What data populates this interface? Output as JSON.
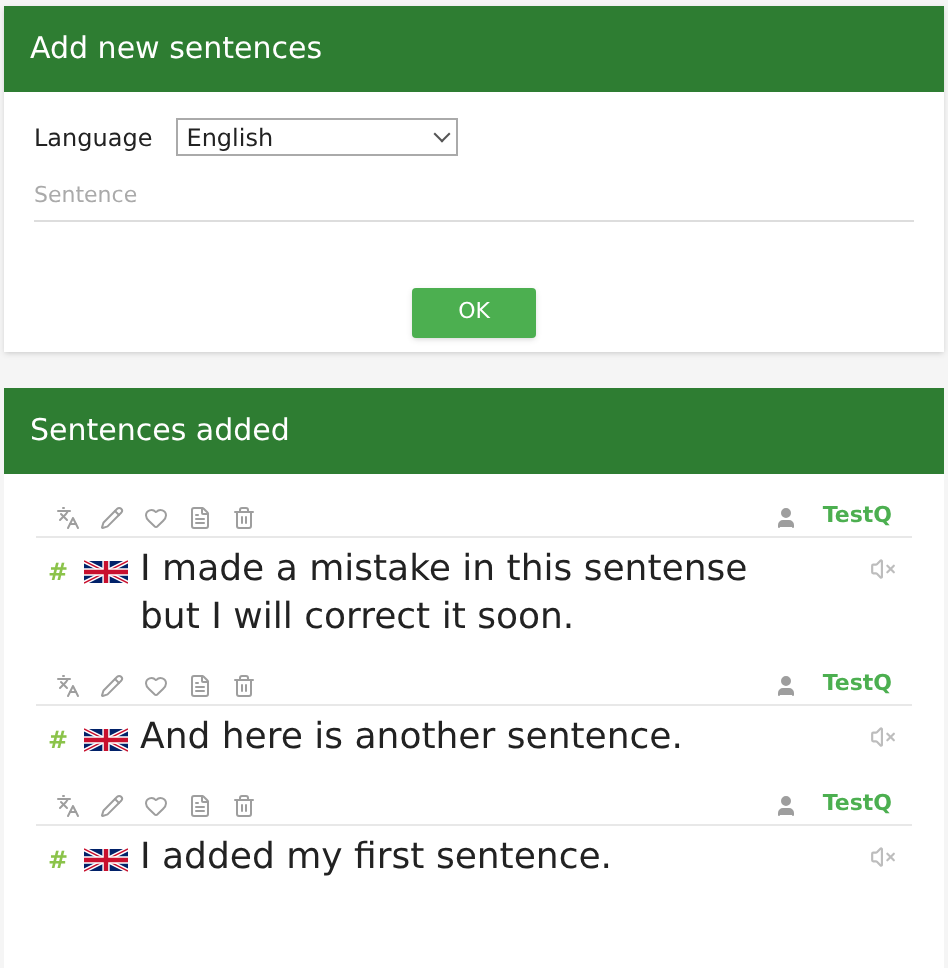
{
  "add_panel": {
    "title": "Add new sentences",
    "language_label": "Language",
    "language_value": "English",
    "sentence_placeholder": "Sentence",
    "ok_button": "OK"
  },
  "added_panel": {
    "title": "Sentences added",
    "sentences": [
      {
        "hash": "#",
        "text": "I made a mistake in this sentense but I will correct it soon.",
        "user": "TestQ"
      },
      {
        "hash": "#",
        "text": "And here is another sentence.",
        "user": "TestQ"
      },
      {
        "hash": "#",
        "text": "I added my first sentence.",
        "user": "TestQ"
      }
    ]
  }
}
